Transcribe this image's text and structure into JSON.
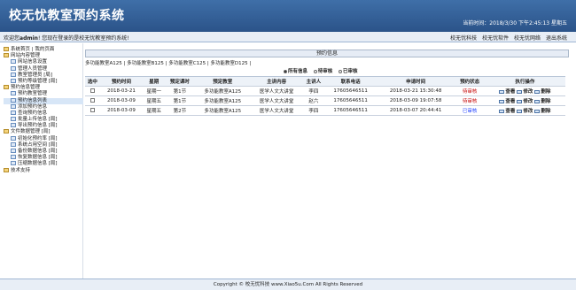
{
  "header": {
    "title": "校无忧教室预约系统",
    "time_label": "当前时间：",
    "time_value": "2018/3/30 下午2:45:13 星期五"
  },
  "welcome": {
    "prefix": "欢迎您",
    "user": "admin",
    "suffix": "! 您现在登录的是校无忧教室预约系统!"
  },
  "top_links": [
    "校无忧科技",
    "校无忧软件",
    "校无忧网络",
    "退出系统"
  ],
  "sidebar": {
    "items": [
      {
        "label": "系统首页 | 我的页面",
        "level": 1,
        "selected": false
      },
      {
        "label": "网站内容管理",
        "level": 1,
        "selected": false
      },
      {
        "label": "网站信息设置",
        "level": 2,
        "selected": false
      },
      {
        "label": "管理人员管理",
        "level": 2,
        "selected": false
      },
      {
        "label": "教室管理员 [局]",
        "level": 2,
        "selected": false
      },
      {
        "label": "预约等级管理 [局]",
        "level": 2,
        "selected": false
      },
      {
        "label": "预约信息管理",
        "level": 1,
        "selected": false
      },
      {
        "label": "预约教室管理",
        "level": 2,
        "selected": false
      },
      {
        "label": "预约信息列表",
        "level": 2,
        "selected": true
      },
      {
        "label": "添加预约信息",
        "level": 2,
        "selected": false
      },
      {
        "label": "查询预约信息",
        "level": 2,
        "selected": false
      },
      {
        "label": "批量上传信息 [局]",
        "level": 2,
        "selected": false
      },
      {
        "label": "导出预约信息 [局]",
        "level": 2,
        "selected": false
      },
      {
        "label": "文件数据管理 [局]",
        "level": 1,
        "selected": false
      },
      {
        "label": "初始化预约率 [局]",
        "level": 2,
        "selected": false
      },
      {
        "label": "系统占用空间 [局]",
        "level": 2,
        "selected": false
      },
      {
        "label": "备份数据信息 [局]",
        "level": 2,
        "selected": false
      },
      {
        "label": "恢复数据信息 [局]",
        "level": 2,
        "selected": false
      },
      {
        "label": "压缩数据信息 [局]",
        "level": 2,
        "selected": false
      },
      {
        "label": "技术支持",
        "level": 1,
        "selected": false
      }
    ]
  },
  "main": {
    "panel_title": "预约信息",
    "classrooms": "多功能教室A125 | 多功能教室B125 | 多功能教室C125 | 多功能教室D125 |",
    "filters": [
      "所有信息",
      "待审核",
      "已审核"
    ],
    "table": {
      "headers": [
        "选中",
        "预约时间",
        "星期",
        "预定课时",
        "预定教室",
        "主讲内容",
        "主讲人",
        "联系电话",
        "申请时间",
        "预约状态",
        "执行操作"
      ],
      "rows": [
        [
          "",
          "2018-03-21",
          "星期一",
          "第1节",
          "多功能教室A125",
          "医学人文大讲堂",
          "李四",
          "17605646511",
          "2018-03-21 15:30:48",
          "待审核"
        ],
        [
          "",
          "2018-03-09",
          "星期五",
          "第1节",
          "多功能教室A125",
          "医学人文大讲堂",
          "赵六",
          "17605646511",
          "2018-03-09 19:07:58",
          "待审核"
        ],
        [
          "",
          "2018-03-09",
          "星期五",
          "第2节",
          "多功能教室A125",
          "医学人文大讲堂",
          "李四",
          "17605646511",
          "2018-03-07 20:44:41",
          "已审核"
        ]
      ],
      "ops": [
        "查看",
        "修改",
        "删除"
      ]
    }
  },
  "footer": {
    "text": "Copyright © 校无忧科技 www.Xiao5u.Com All Rights Reserved"
  }
}
